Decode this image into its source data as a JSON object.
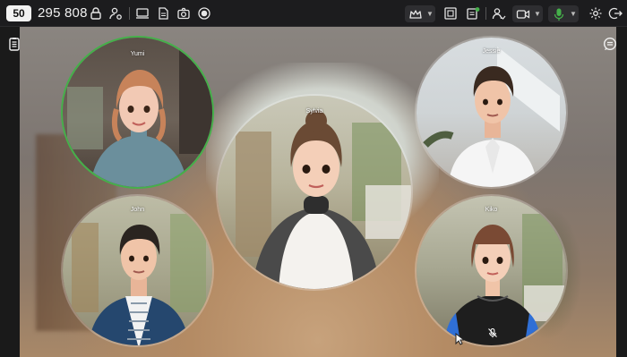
{
  "toolbar": {
    "participant_count": "50",
    "room_id": "295 808"
  },
  "participants": [
    {
      "name": "Yumi"
    },
    {
      "name": "Jessie"
    },
    {
      "name": "Sylvia"
    },
    {
      "name": "John"
    },
    {
      "name": "Kiko"
    }
  ],
  "colors": {
    "speaking_ring": "#45b04a",
    "mic_active": "#45b04a",
    "topbar_bg": "#1c1c1e"
  },
  "icons": {
    "left": [
      "lock-icon",
      "users-settings-icon",
      "screen-share-icon",
      "document-icon",
      "camera-icon",
      "record-icon"
    ],
    "right": [
      "crown-icon",
      "layout-icon",
      "chat-notes-icon",
      "participants-icon",
      "video-icon",
      "microphone-icon",
      "settings-icon",
      "leave-icon"
    ],
    "stage": [
      "notes-panel-icon",
      "chat-bubble-icon",
      "mic-off-icon"
    ]
  }
}
